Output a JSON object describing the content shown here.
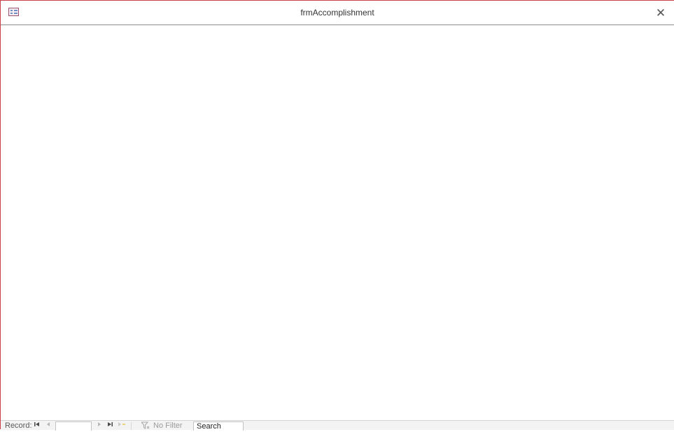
{
  "window": {
    "title": "frmAccomplishment",
    "icon": "form-icon",
    "close_glyph": "✕"
  },
  "navigation": {
    "record_label": "Record:",
    "first_glyph": "⏮",
    "prev_glyph": "◀",
    "record_value": "",
    "next_glyph": "▶",
    "last_glyph": "⏭",
    "new_glyph": "▶*",
    "filter_status": "No Filter",
    "search_placeholder": "Search"
  },
  "colors": {
    "window_border": "#c8404a",
    "title_text": "#333333",
    "navbar_bg": "#f3f3f3"
  }
}
